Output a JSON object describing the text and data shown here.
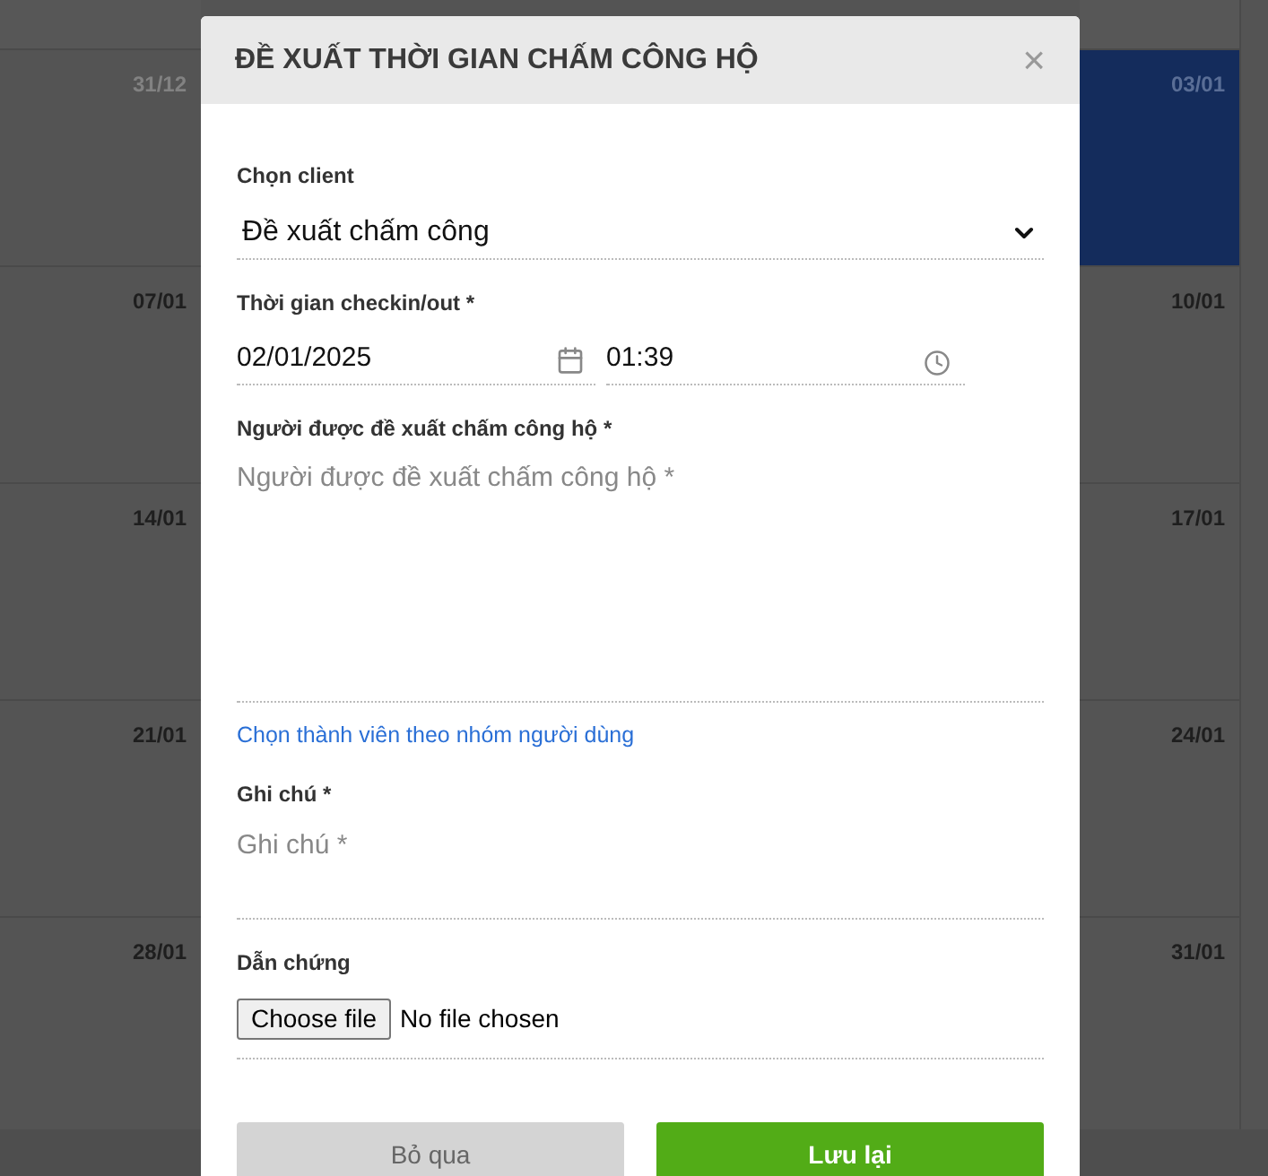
{
  "calendar": {
    "left_column": [
      {
        "date": "31/12",
        "other_month": true,
        "selected": false
      },
      {
        "date": "07/01",
        "other_month": false,
        "selected": false
      },
      {
        "date": "14/01",
        "other_month": false,
        "selected": false
      },
      {
        "date": "21/01",
        "other_month": false,
        "selected": false
      },
      {
        "date": "28/01",
        "other_month": false,
        "selected": false
      }
    ],
    "right_column": [
      {
        "date": "03/01",
        "other_month": false,
        "selected": true
      },
      {
        "date": "10/01",
        "other_month": false,
        "selected": false
      },
      {
        "date": "17/01",
        "other_month": false,
        "selected": false
      },
      {
        "date": "24/01",
        "other_month": false,
        "selected": false
      },
      {
        "date": "31/01",
        "other_month": false,
        "selected": false
      }
    ]
  },
  "dialog": {
    "title": "ĐỀ XUẤT THỜI GIAN CHẤM CÔNG HỘ",
    "close": "×",
    "client": {
      "label": "Chọn client",
      "value": "Đề xuất chấm công"
    },
    "checkin": {
      "label": "Thời gian checkin/out *",
      "date": "02/01/2025",
      "time": "01:39"
    },
    "person": {
      "label": "Người được đề xuất chấm công hộ *",
      "placeholder": "Người được đề xuất chấm công hộ *"
    },
    "group_link": "Chọn thành viên theo nhóm người dùng",
    "note": {
      "label": "Ghi chú *",
      "placeholder": "Ghi chú *"
    },
    "evidence": {
      "label": "Dẫn chứng",
      "button": "Choose file",
      "status": "No file chosen"
    },
    "buttons": {
      "cancel": "Bỏ qua",
      "save": "Lưu lại"
    }
  }
}
